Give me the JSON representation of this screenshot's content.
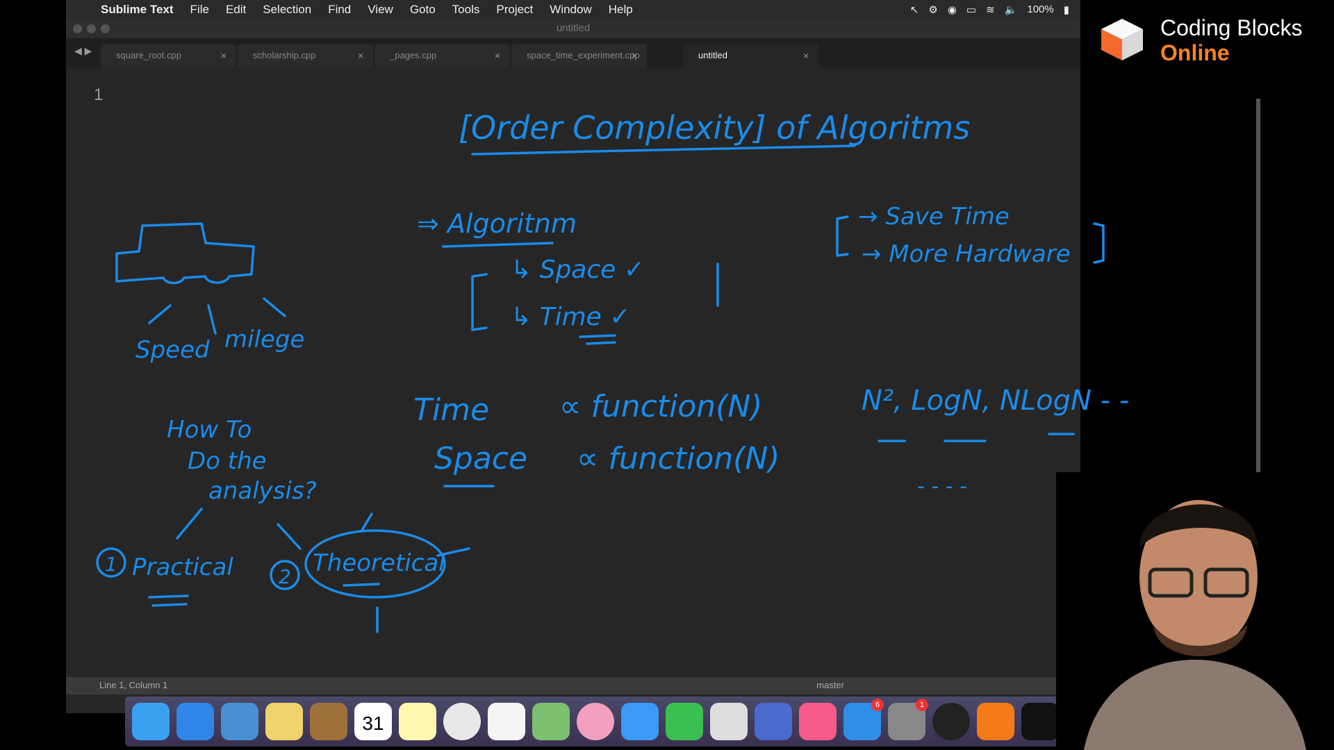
{
  "menubar": {
    "app_name": "Sublime Text",
    "items": [
      "File",
      "Edit",
      "Selection",
      "Find",
      "View",
      "Goto",
      "Tools",
      "Project",
      "Window",
      "Help"
    ],
    "battery": "100%"
  },
  "window": {
    "title": "untitled",
    "tabs": [
      {
        "label": "square_root.cpp",
        "active": false
      },
      {
        "label": "scholarship.cpp",
        "active": false
      },
      {
        "label": "_pages.cpp",
        "active": false
      },
      {
        "label": "space_time_experiment.cpp",
        "active": false
      },
      {
        "label": "untitled",
        "active": true
      }
    ],
    "line_number": "1",
    "status_left": "Line 1, Column 1",
    "status_right": "master"
  },
  "brand": {
    "line1": "Coding Blocks",
    "line2": "Online",
    "accent": "#f6831f"
  },
  "notes": {
    "title": "[Order Complexity] of Algoritms",
    "algorithm": "⇒ Algoritnm",
    "space": "↳ Space ✓",
    "time": "↳ Time ✓",
    "save_time": "→ Save Time",
    "more_hardware": "→ More Hardware",
    "speed": "Speed",
    "milege": "milege",
    "how_to_1": "How To",
    "how_to_2": "Do the",
    "how_to_3": "analysis?",
    "practical": "Practical",
    "theoretical": "Theoretical",
    "num1": "1",
    "num2": "2",
    "time_formula_lhs": "Time",
    "time_formula_rhs": "∝ function(N)",
    "space_formula_lhs": "Space",
    "space_formula_rhs": "∝ function(N)",
    "orders": "N², LogN, NLogN - -",
    "dashes": "- - - -"
  },
  "dock": {
    "calendar_day": "31",
    "badges": [
      "6",
      "1"
    ]
  },
  "colors": {
    "ink": "#1b8be8",
    "editor_bg": "#262626"
  }
}
